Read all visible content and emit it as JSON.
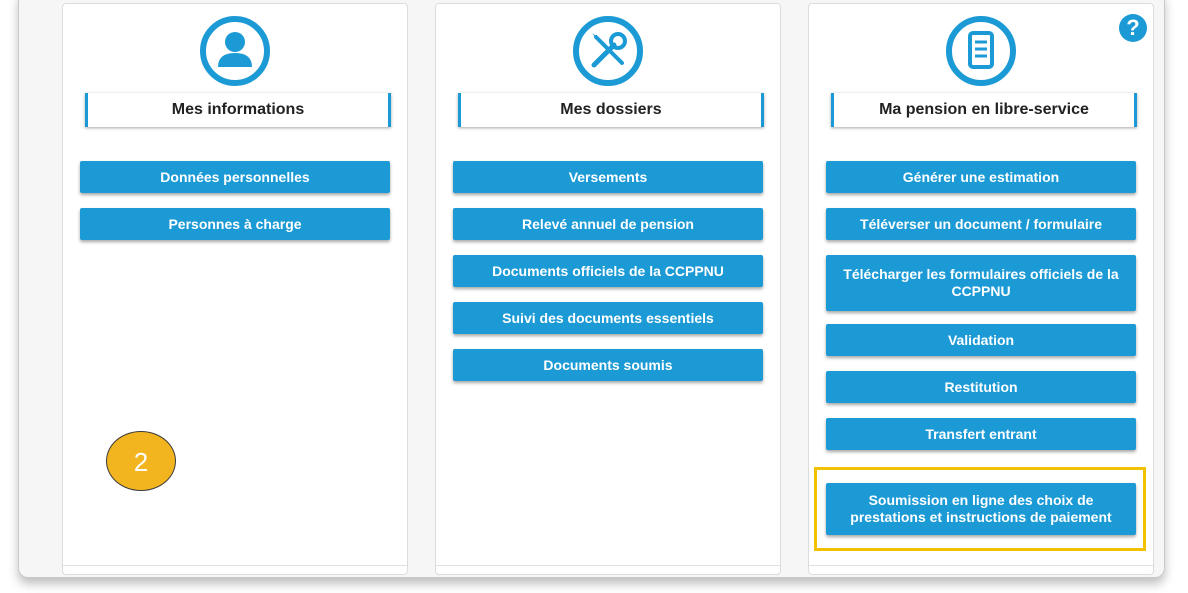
{
  "cards": [
    {
      "title": "Mes informations",
      "icon": "user-icon",
      "buttons": [
        "Données personnelles",
        "Personnes à charge"
      ]
    },
    {
      "title": "Mes dossiers",
      "icon": "tools-icon",
      "buttons": [
        "Versements",
        "Relevé annuel de pension",
        "Documents officiels de la CCPPNU",
        "Suivi des documents essentiels",
        "Documents soumis"
      ]
    },
    {
      "title": "Ma pension en libre-service",
      "icon": "document-icon",
      "buttons": [
        "Générer une estimation",
        "Téléverser un document / formulaire",
        "Télécharger les formulaires officiels de la CCPPNU",
        "Validation",
        "Restitution",
        "Transfert entrant",
        "Soumission en ligne des choix de prestations et instructions de paiement"
      ]
    }
  ],
  "help": {
    "symbol": "?"
  },
  "step_badge": "2",
  "colors": {
    "accent": "#1b9ad6",
    "highlight": "#f2c200",
    "badge": "#f2b51f"
  }
}
